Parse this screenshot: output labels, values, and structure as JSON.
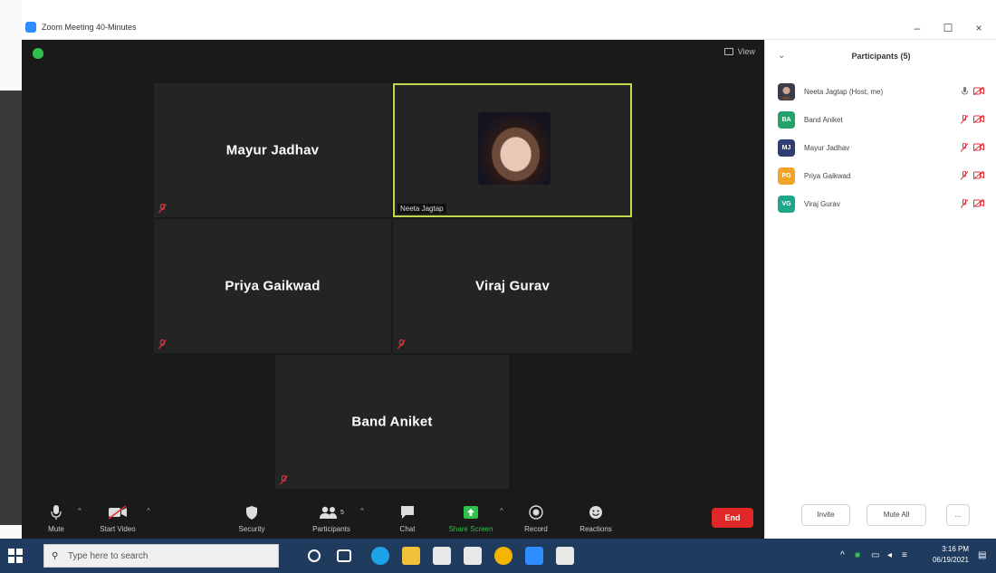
{
  "window": {
    "title": "Zoom Meeting 40-Minutes",
    "minimize": "–",
    "maximize": "☐",
    "close": "×"
  },
  "meeting": {
    "view_label": "View",
    "tiles": [
      {
        "name": "Mayur Jadhav"
      },
      {
        "name": "Neeta Jagtap",
        "label": "Neeta Jagtap"
      },
      {
        "name": "Priya Gaikwad"
      },
      {
        "name": "Viraj Gurav"
      },
      {
        "name": "Band Aniket"
      }
    ]
  },
  "toolbar": {
    "mute": "Mute",
    "start_video": "Start Video",
    "security": "Security",
    "participants": "Participants",
    "participants_count": "5",
    "chat": "Chat",
    "share_screen": "Share Screen",
    "record": "Record",
    "reactions": "Reactions",
    "end": "End"
  },
  "participants_panel": {
    "title": "Participants (5)",
    "list": [
      {
        "name": "Neeta Jagtap (Host, me)",
        "initials": "",
        "color": "#555555"
      },
      {
        "name": "Band Aniket",
        "initials": "BA",
        "color": "#23a36b"
      },
      {
        "name": "Mayur Jadhav",
        "initials": "MJ",
        "color": "#2f3d74"
      },
      {
        "name": "Priya Gaikwad",
        "initials": "PG",
        "color": "#f1a428"
      },
      {
        "name": "Viraj Gurav",
        "initials": "VG",
        "color": "#1fa58a"
      }
    ],
    "invite": "Invite",
    "mute_all": "Mute All",
    "more": "..."
  },
  "taskbar": {
    "search_placeholder": "Type here to search",
    "time": "3:16 PM",
    "date": "06/19/2021"
  },
  "colors": {
    "meeting_bg": "#1a1a1a",
    "tile_bg": "#242424",
    "active_speaker": "#c6d64b",
    "end_button": "#e02828",
    "share_green": "#2fbf4a",
    "taskbar": "#1f3b5e"
  }
}
